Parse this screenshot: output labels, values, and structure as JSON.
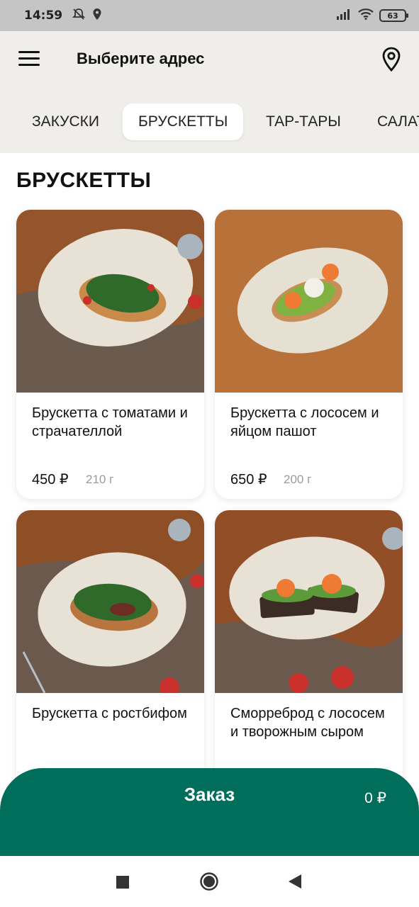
{
  "status_bar": {
    "time": "14:59",
    "battery": "63"
  },
  "header": {
    "address_placeholder": "Выберите адрес"
  },
  "tabs": [
    {
      "label": "ЗАКУСКИ",
      "active": false
    },
    {
      "label": "БРУСКЕТТЫ",
      "active": true
    },
    {
      "label": "ТАР-ТАРЫ",
      "active": false
    },
    {
      "label": "САЛАТЫ",
      "active": false
    }
  ],
  "section": {
    "title": "БРУСКЕТТЫ"
  },
  "products": [
    {
      "name": "Брускетта с томатами и страчателлой",
      "price": "450 ₽",
      "weight": "210 г"
    },
    {
      "name": "Брускетта с лососем и яйцом пашот",
      "price": "650 ₽",
      "weight": "200 г"
    },
    {
      "name": "Брускетта с ростбифом",
      "price": "",
      "weight": ""
    },
    {
      "name": "Сморреброд с лососем и творожным сыром",
      "price": "",
      "weight": ""
    }
  ],
  "order": {
    "label": "Заказ",
    "total": "0 ₽"
  },
  "colors": {
    "accent": "#006e5b",
    "header_bg": "#efeeea",
    "status_bg": "#c5c5c5"
  }
}
